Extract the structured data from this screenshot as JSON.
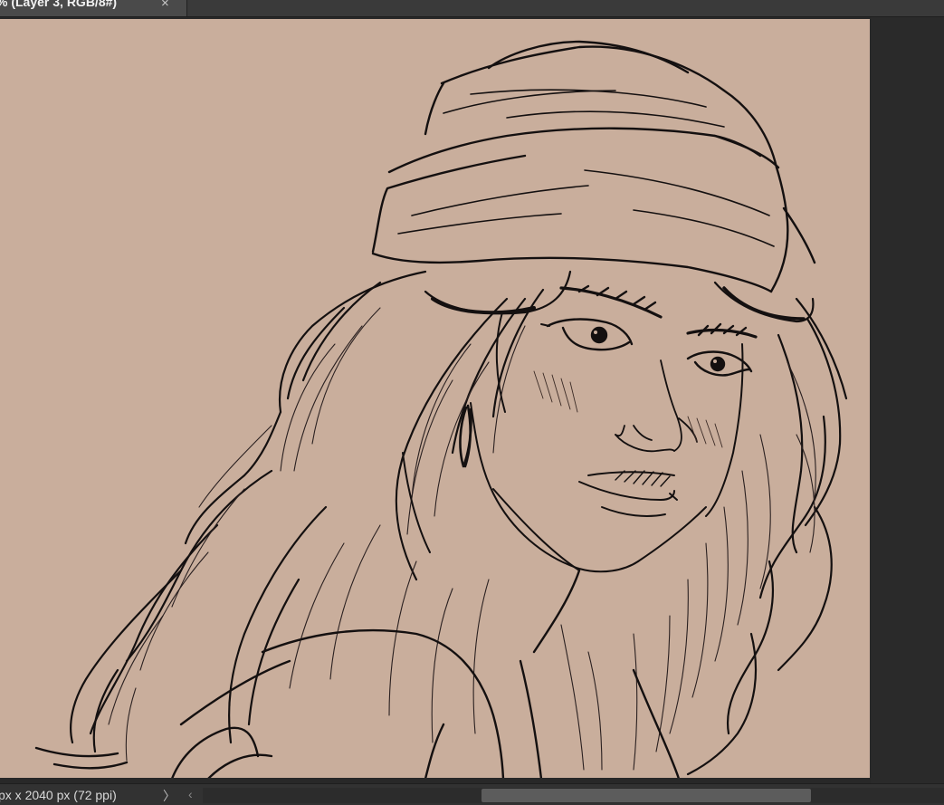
{
  "document_tab": {
    "title": "% (Layer 3, RGB/8#)",
    "close_glyph": "×"
  },
  "canvas": {
    "background_color": "#c9ae9c",
    "artwork": "line-art-sketch"
  },
  "status_bar": {
    "doc_size": "px x 2040 px (72 ppi)",
    "arrow_glyph": "〉",
    "scroll_left_glyph": "‹"
  },
  "colors": {
    "app_bg": "#2b2b2b",
    "tab_bg": "#4a4a4a",
    "ink": "#141010"
  }
}
